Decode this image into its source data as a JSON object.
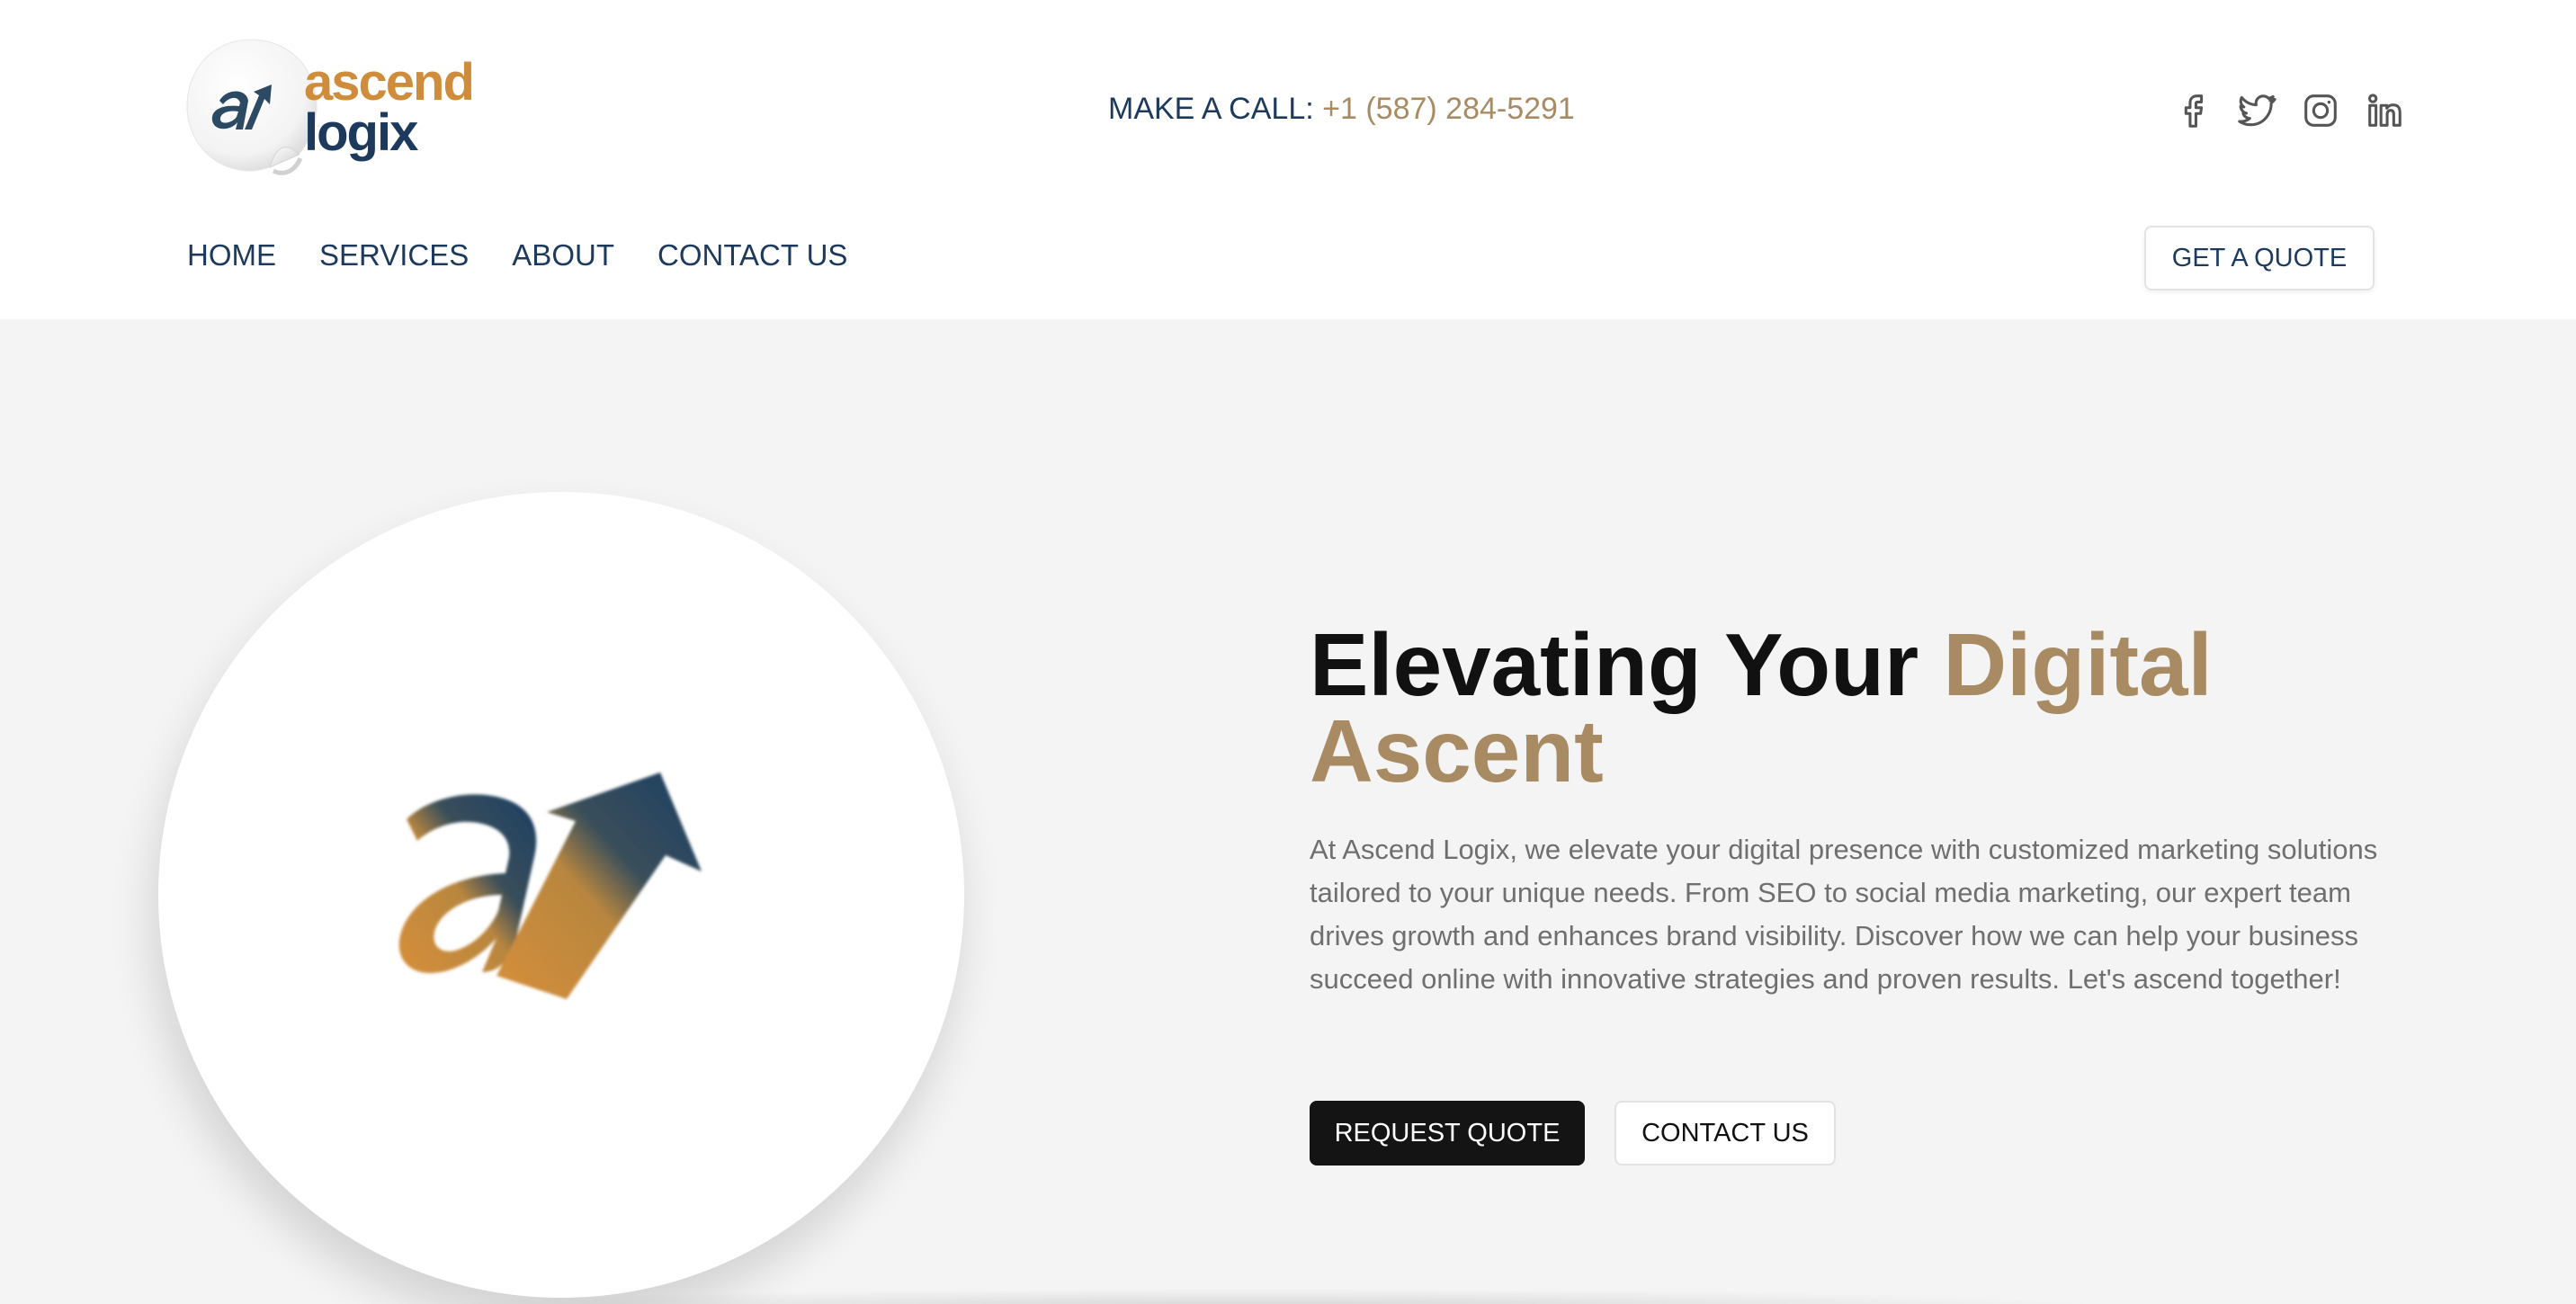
{
  "brand": {
    "name_line1": "ascend",
    "name_line2": "logix",
    "colors": {
      "orange": "#cf8c3a",
      "navy": "#1d3a5c",
      "gold": "#a88b63"
    }
  },
  "contact": {
    "label": "MAKE A CALL:",
    "phone": "+1 (587) 284-5291"
  },
  "social": [
    {
      "name": "facebook-icon"
    },
    {
      "name": "twitter-icon"
    },
    {
      "name": "instagram-icon"
    },
    {
      "name": "linkedin-icon"
    }
  ],
  "nav": {
    "items": [
      "HOME",
      "SERVICES",
      "ABOUT",
      "CONTACT US"
    ],
    "cta": "GET A QUOTE"
  },
  "hero": {
    "title_plain": "Elevating Your ",
    "title_accent_1": "Digital",
    "title_accent_2": "Ascent",
    "description": "At Ascend Logix, we elevate your digital presence with customized marketing solutions tailored to your unique needs. From SEO to social media marketing, our expert team drives growth and enhances brand visibility. Discover how we can help your business succeed online with innovative strategies and proven results. Let's ascend together!",
    "primary_button": "REQUEST QUOTE",
    "secondary_button": "CONTACT US"
  }
}
